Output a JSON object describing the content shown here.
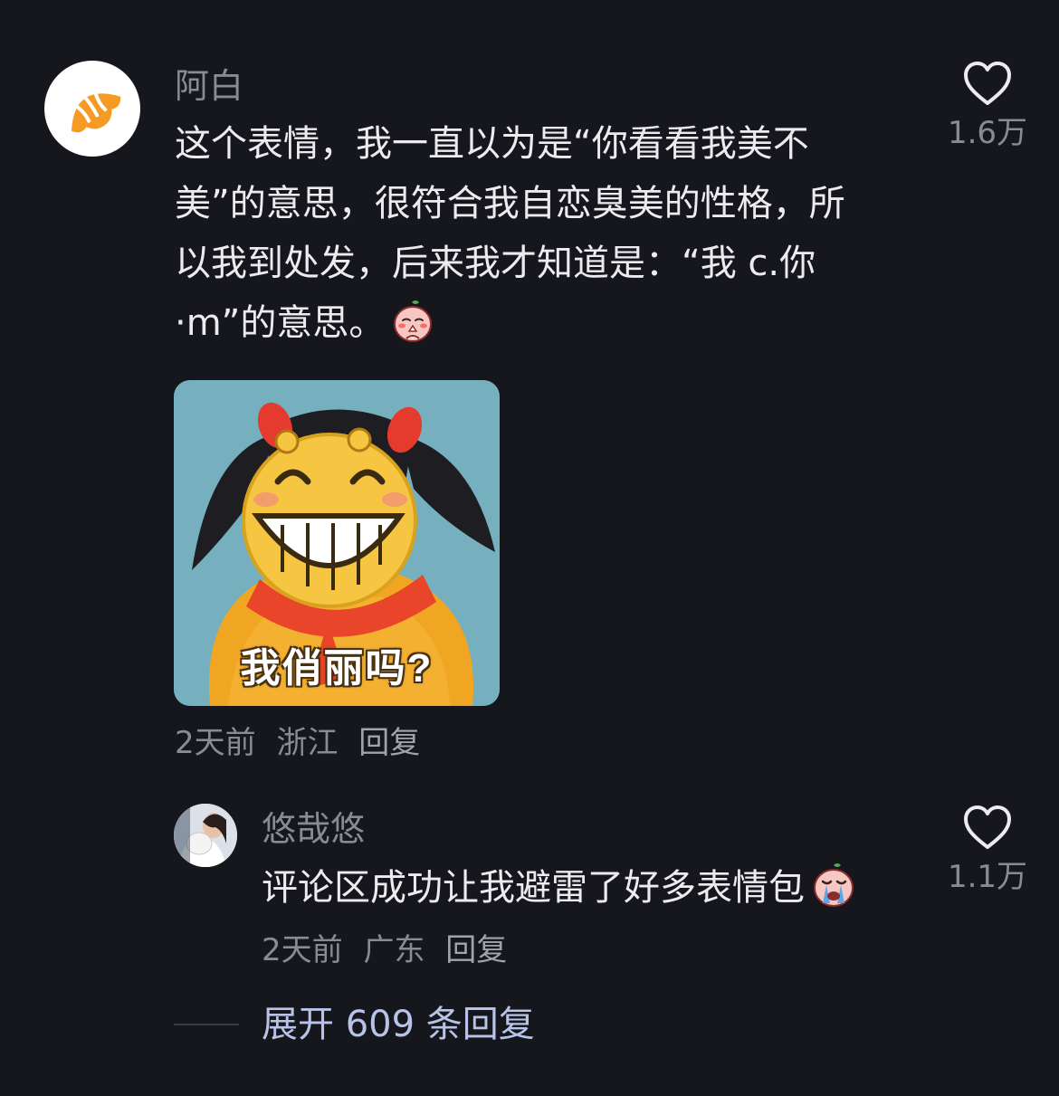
{
  "comment": {
    "username": "阿白",
    "text_lines": [
      "这个表情，我一直以为是“你看看我美不",
      "美”的意思，很符合我自恋臭美的性格，所",
      "以我到处发，后来我才知道是：“我 c.你",
      "·m”的意思。"
    ],
    "inline_emoji": "praying-bun-emoji",
    "sticker": {
      "caption": "我俏丽吗?",
      "colors": {
        "background": "#6aa6b8",
        "face": "#f6c542",
        "hair": "#1d1d22",
        "body": "#f1a623",
        "scarf": "#e8452a"
      }
    },
    "meta": {
      "time": "2天前",
      "location": "浙江",
      "reply": "回复"
    },
    "likes": "1.6万",
    "avatar_icon": "croissant-icon"
  },
  "reply": {
    "username": "悠哉悠",
    "text": "评论区成功让我避雷了好多表情包",
    "inline_emoji": "crying-bun-emoji",
    "meta": {
      "time": "2天前",
      "location": "广东",
      "reply": "回复"
    },
    "likes": "1.1万"
  },
  "expand": {
    "label": "展开 609 条回复"
  },
  "colors": {
    "background": "#16161d",
    "text": "#ececf0",
    "muted": "#8a8a93",
    "link": "#b7c4e8",
    "croissant": "#f59a23"
  }
}
